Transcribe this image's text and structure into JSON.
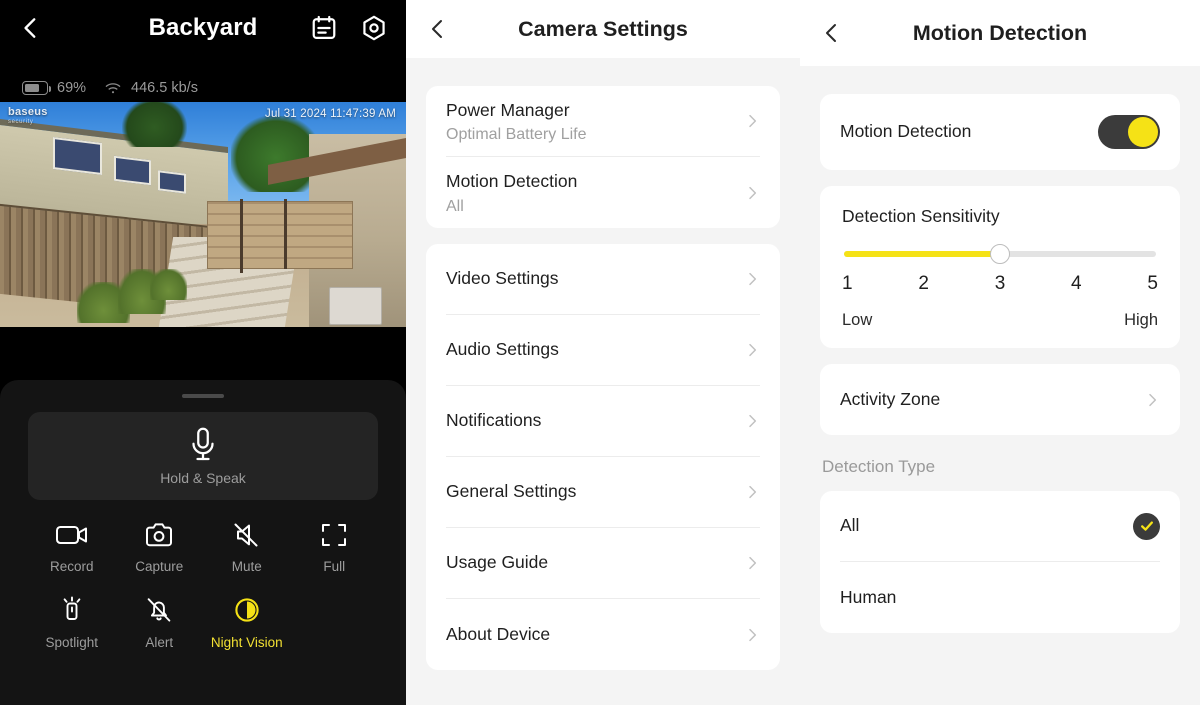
{
  "live": {
    "title": "Backyard",
    "back_icon": "chevron-left-icon",
    "events_icon": "calendar-events-icon",
    "settings_icon": "hex-gear-icon",
    "status": {
      "battery_percent": "69%",
      "battery_level": 69,
      "bitrate": "446.5 kb/s",
      "battery_icon": "battery-icon",
      "wifi_icon": "wifi-icon"
    },
    "video": {
      "watermark": "baseus",
      "watermark_sub": "security",
      "timestamp": "Jul 31 2024 11:47:39 AM"
    },
    "talk": {
      "label": "Hold & Speak",
      "icon": "microphone-icon"
    },
    "controls": [
      {
        "label": "Record",
        "icon": "video-camera-icon",
        "active": false
      },
      {
        "label": "Capture",
        "icon": "camera-icon",
        "active": false
      },
      {
        "label": "Mute",
        "icon": "speaker-muted-icon",
        "active": false
      },
      {
        "label": "Full",
        "icon": "fullscreen-icon",
        "active": false
      },
      {
        "label": "Spotlight",
        "icon": "flashlight-icon",
        "active": false
      },
      {
        "label": "Alert",
        "icon": "bell-off-icon",
        "active": false
      },
      {
        "label": "Night Vision",
        "icon": "night-vision-icon",
        "active": true
      }
    ]
  },
  "settings": {
    "title": "Camera Settings",
    "back_icon": "chevron-left-icon",
    "group1": [
      {
        "title": "Power Manager",
        "sub": "Optimal Battery Life"
      },
      {
        "title": "Motion Detection",
        "sub": "All"
      }
    ],
    "group2": [
      {
        "title": "Video Settings"
      },
      {
        "title": "Audio Settings"
      },
      {
        "title": "Notifications"
      },
      {
        "title": "General Settings"
      },
      {
        "title": "Usage Guide"
      },
      {
        "title": "About Device"
      }
    ]
  },
  "motion": {
    "title": "Motion Detection",
    "back_icon": "chevron-left-icon",
    "toggle": {
      "label": "Motion Detection",
      "on": true
    },
    "sensitivity": {
      "title": "Detection Sensitivity",
      "value": 3,
      "ticks": [
        "1",
        "2",
        "3",
        "4",
        "5"
      ],
      "low_label": "Low",
      "high_label": "High"
    },
    "activity_zone": {
      "title": "Activity Zone"
    },
    "detection_type": {
      "section_label": "Detection Type",
      "options": [
        {
          "label": "All",
          "selected": true
        },
        {
          "label": "Human",
          "selected": false
        }
      ]
    }
  },
  "colors": {
    "accent_yellow": "#F5E216",
    "dark_surface": "#141414",
    "page_bg": "#F4F4F4",
    "card_bg": "#FFFFFF",
    "muted_text": "#A0A0A0"
  }
}
